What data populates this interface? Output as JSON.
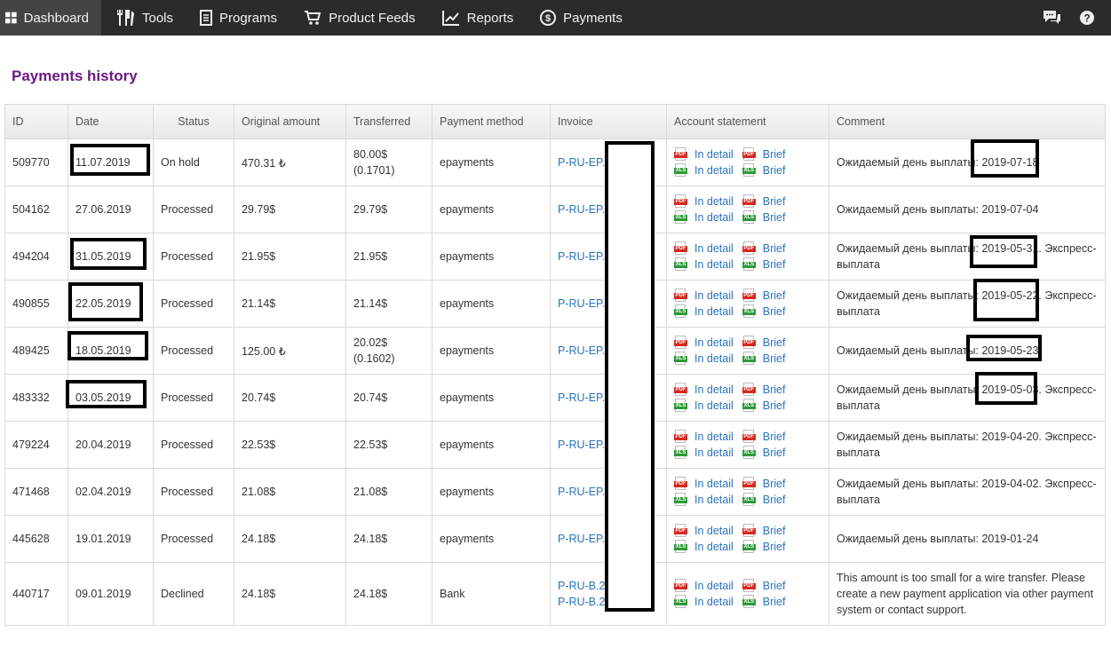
{
  "nav": {
    "items": [
      {
        "label": "Dashboard",
        "icon": "grid-icon",
        "active": true
      },
      {
        "label": "Tools",
        "icon": "tools-icon"
      },
      {
        "label": "Programs",
        "icon": "document-icon"
      },
      {
        "label": "Product Feeds",
        "icon": "cart-icon"
      },
      {
        "label": "Reports",
        "icon": "chart-icon"
      },
      {
        "label": "Payments",
        "icon": "dollar-icon"
      }
    ],
    "right_icons": [
      "chat-icon",
      "help-icon"
    ]
  },
  "page": {
    "title": "Payments history"
  },
  "table": {
    "headers": {
      "id": "ID",
      "date": "Date",
      "status": "Status",
      "original": "Original amount",
      "transferred": "Transferred",
      "method": "Payment method",
      "invoice": "Invoice",
      "statement": "Account statement",
      "comment": "Comment"
    },
    "statement_labels": {
      "detail": "In detail",
      "brief": "Brief",
      "pdf_tag": "PDF",
      "xls_tag": "XLS"
    },
    "rows": [
      {
        "id": "509770",
        "date": "11.07.2019",
        "status": "On hold",
        "original": "470.31 ₺",
        "transferred": "80.00$",
        "transferred_sub": "(0.1701)",
        "method": "epayments",
        "invoice": "P-RU-EP.",
        "invoice2": "",
        "comment": "Ожидаемый день выплаты: 2019-07-18",
        "comment2": ""
      },
      {
        "id": "504162",
        "date": "27.06.2019",
        "status": "Processed",
        "original": "29.79$",
        "transferred": "29.79$",
        "transferred_sub": "",
        "method": "epayments",
        "invoice": "P-RU-EP.",
        "invoice2": "",
        "comment": "Ожидаемый день выплаты: 2019-07-04",
        "comment2": ""
      },
      {
        "id": "494204",
        "date": "31.05.2019",
        "status": "Processed",
        "original": "21.95$",
        "transferred": "21.95$",
        "transferred_sub": "",
        "method": "epayments",
        "invoice": "P-RU-EP.",
        "invoice2": "",
        "comment": "Ожидаемый день выплаты: 2019-05-31. Экспресс-",
        "comment2": "выплата"
      },
      {
        "id": "490855",
        "date": "22.05.2019",
        "status": "Processed",
        "original": "21.14$",
        "transferred": "21.14$",
        "transferred_sub": "",
        "method": "epayments",
        "invoice": "P-RU-EP.",
        "invoice2": "",
        "comment": "Ожидаемый день выплаты: 2019-05-22. Экспресс-",
        "comment2": "выплата"
      },
      {
        "id": "489425",
        "date": "18.05.2019",
        "status": "Processed",
        "original": "125.00 ₺",
        "transferred": "20.02$",
        "transferred_sub": "(0.1602)",
        "method": "epayments",
        "invoice": "P-RU-EP.",
        "invoice2": "",
        "comment": "Ожидаемый день выплаты: 2019-05-23",
        "comment2": ""
      },
      {
        "id": "483332",
        "date": "03.05.2019",
        "status": "Processed",
        "original": "20.74$",
        "transferred": "20.74$",
        "transferred_sub": "",
        "method": "epayments",
        "invoice": "P-RU-EP.",
        "invoice2": "",
        "comment": "Ожидаемый день выплаты: 2019-05-03. Экспресс-",
        "comment2": "выплата"
      },
      {
        "id": "479224",
        "date": "20.04.2019",
        "status": "Processed",
        "original": "22.53$",
        "transferred": "22.53$",
        "transferred_sub": "",
        "method": "epayments",
        "invoice": "P-RU-EP.",
        "invoice2": "",
        "comment": "Ожидаемый день выплаты: 2019-04-20. Экспресс-",
        "comment2": "выплата"
      },
      {
        "id": "471468",
        "date": "02.04.2019",
        "status": "Processed",
        "original": "21.08$",
        "transferred": "21.08$",
        "transferred_sub": "",
        "method": "epayments",
        "invoice": "P-RU-EP.",
        "invoice2": "",
        "comment": "Ожидаемый день выплаты: 2019-04-02. Экспресс-",
        "comment2": "выплата"
      },
      {
        "id": "445628",
        "date": "19.01.2019",
        "status": "Processed",
        "original": "24.18$",
        "transferred": "24.18$",
        "transferred_sub": "",
        "method": "epayments",
        "invoice": "P-RU-EP.",
        "invoice2": "",
        "comment": "Ожидаемый день выплаты: 2019-01-24",
        "comment2": ""
      },
      {
        "id": "440717",
        "date": "09.01.2019",
        "status": "Declined",
        "original": "24.18$",
        "transferred": "24.18$",
        "transferred_sub": "",
        "method": "Bank",
        "invoice": "P-RU-B.2",
        "invoice2": "P-RU-B.2",
        "comment": "This amount is too small for a wire transfer. Please create a new payment application via other payment system or contact support.",
        "comment2": ""
      }
    ]
  }
}
